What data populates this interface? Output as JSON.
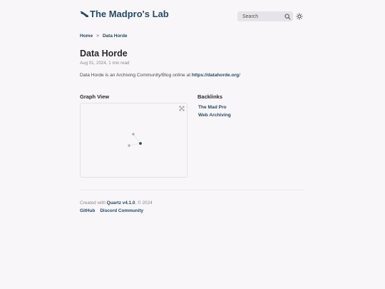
{
  "header": {
    "site_title": "The Madpro's Lab",
    "logo_icon": "lab-logo-icon",
    "search": {
      "placeholder": "Search",
      "icon": "search-icon"
    },
    "theme_toggle_icon": "sun-icon"
  },
  "breadcrumb": {
    "items": [
      "Home",
      "Data Horde"
    ],
    "separator": ">"
  },
  "article": {
    "title": "Data Horde",
    "meta": "Aug 01, 2024, 1 min read",
    "body_prefix": "Data Horde is an Archiving Community/Blog online at ",
    "body_link": "https://datahorde.org",
    "body_suffix": "/"
  },
  "graph": {
    "heading": "Graph View",
    "expand_icon": "expand-icon"
  },
  "backlinks": {
    "heading": "Backlinks",
    "items": [
      "The Mad Pro",
      "Web Archiving"
    ]
  },
  "footer": {
    "created_prefix": "Created with ",
    "quartz_label": "Quartz v4.1.0",
    "created_suffix": ", © 2024",
    "links": [
      "GitHub",
      "Discord Community"
    ]
  },
  "colors": {
    "accent": "#284b63",
    "background": "#f8f6f8",
    "graph_node": "#b0b0b0",
    "graph_active_node": "#284b63"
  }
}
